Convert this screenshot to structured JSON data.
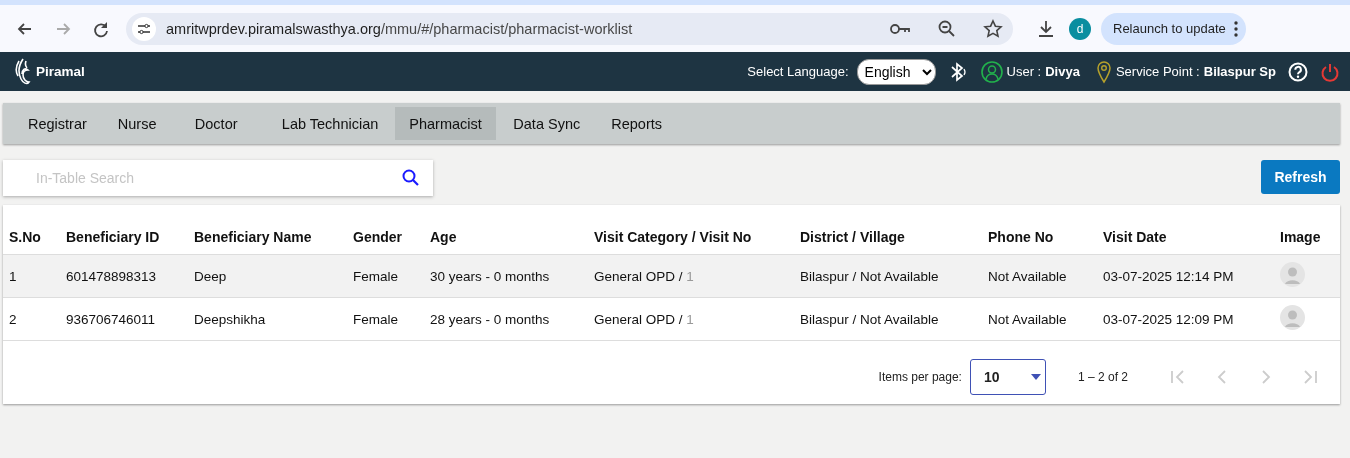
{
  "browser": {
    "url_host": "amritwprdev.piramalswasthya.org",
    "url_path": "/mmu/#/pharmacist/pharmacist-worklist",
    "profile_initial": "d",
    "relaunch": "Relaunch to update"
  },
  "header": {
    "brand": "Piramal",
    "language_label": "Select Language:",
    "language": "English",
    "user_label": "User :",
    "user": "Divya",
    "service_point_label": "Service Point :",
    "service_point": "Bilaspur Sp"
  },
  "tabs": [
    {
      "label": "Registrar",
      "selected": false
    },
    {
      "label": "Nurse",
      "selected": false
    },
    {
      "label": "Doctor",
      "selected": false
    },
    {
      "label": "Lab Technician",
      "selected": false
    },
    {
      "label": "Pharmacist",
      "selected": true
    },
    {
      "label": "Data Sync",
      "selected": false
    },
    {
      "label": "Reports",
      "selected": false
    }
  ],
  "search": {
    "placeholder": "In-Table Search"
  },
  "refresh_button": "Refresh",
  "table": {
    "columns": [
      "S.No",
      "Beneficiary ID",
      "Beneficiary Name",
      "Gender",
      "Age",
      "Visit Category / Visit No",
      "District / Village",
      "Phone No",
      "Visit Date",
      "Image"
    ],
    "rows": [
      {
        "s_no": "1",
        "beneficiary_id": "601478898313",
        "name": "Deep",
        "gender": "Female",
        "age": "30 years - 0 months",
        "visit_category": "General OPD /",
        "visit_no": "1",
        "district_village": "Bilaspur / Not Available",
        "phone": "Not Available",
        "visit_date": "03-07-2025 12:14 PM",
        "highlighted": true
      },
      {
        "s_no": "2",
        "beneficiary_id": "936706746011",
        "name": "Deepshikha",
        "gender": "Female",
        "age": "28 years - 0 months",
        "visit_category": "General OPD /",
        "visit_no": "1",
        "district_village": "Bilaspur / Not Available",
        "phone": "Not Available",
        "visit_date": "03-07-2025 12:09 PM",
        "highlighted": false
      }
    ]
  },
  "paginator": {
    "label": "Items per page:",
    "page_size": "10",
    "range": "1 – 2 of 2"
  }
}
